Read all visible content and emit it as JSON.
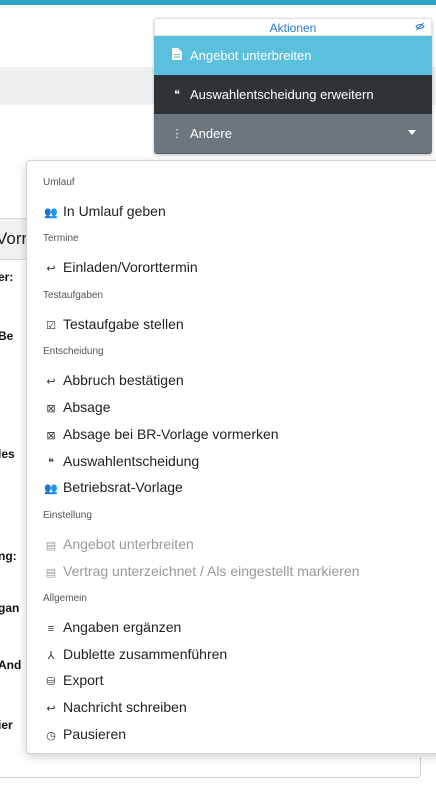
{
  "aktionen": {
    "header": "Aktionen",
    "buttons": {
      "angebot": {
        "label": "Angebot unterbreiten",
        "icon": "document-icon"
      },
      "auswahl": {
        "label": "Auswahlentscheidung erweitern",
        "icon": "quote-icon"
      },
      "andere": {
        "label": "Andere",
        "icon": "vertical-dots-icon"
      }
    }
  },
  "background": {
    "card_text": "Vorr",
    "labels": [
      "er:",
      "Be",
      "les",
      "ng:",
      "gan",
      "And",
      "ier"
    ]
  },
  "menu": {
    "sections": [
      {
        "title": "Umlauf",
        "items": [
          {
            "label": "In Umlauf geben",
            "icon": "people-icon"
          }
        ]
      },
      {
        "title": "Termine",
        "items": [
          {
            "label": "Einladen/Vororttermin",
            "icon": "reply-icon"
          }
        ]
      },
      {
        "title": "Testaufgaben",
        "items": [
          {
            "label": "Testaufgabe stellen",
            "icon": "task-icon"
          }
        ]
      },
      {
        "title": "Entscheidung",
        "items": [
          {
            "label": "Abbruch bestätigen",
            "icon": "reply-icon"
          },
          {
            "label": "Absage",
            "icon": "message-x-icon"
          },
          {
            "label": "Absage bei BR-Vorlage vormerken",
            "icon": "message-x-icon"
          },
          {
            "label": "Auswahlentscheidung",
            "icon": "quote-icon"
          },
          {
            "label": "Betriebsrat-Vorlage",
            "icon": "group-icon"
          }
        ]
      },
      {
        "title": "Einstellung",
        "items": [
          {
            "label": "Angebot unterbreiten",
            "icon": "document-icon"
          },
          {
            "label": "Vertrag unterzeichnet / Als eingestellt markieren",
            "icon": "document-icon"
          }
        ]
      },
      {
        "title": "Allgemein",
        "items": [
          {
            "label": "Angaben ergänzen",
            "icon": "list-edit-icon"
          },
          {
            "label": "Dublette zusammenführen",
            "icon": "merge-icon"
          },
          {
            "label": "Export",
            "icon": "database-icon"
          },
          {
            "label": "Nachricht schreiben",
            "icon": "reply-icon"
          },
          {
            "label": "Pausieren",
            "icon": "pause-clock-icon"
          }
        ]
      }
    ]
  },
  "colors": {
    "accent": "#2aa7c5",
    "primary_button": "#5bc0de",
    "dark_button": "#2e3338",
    "grey_button": "#6d767d",
    "disabled_text": "#9a9a9a"
  }
}
